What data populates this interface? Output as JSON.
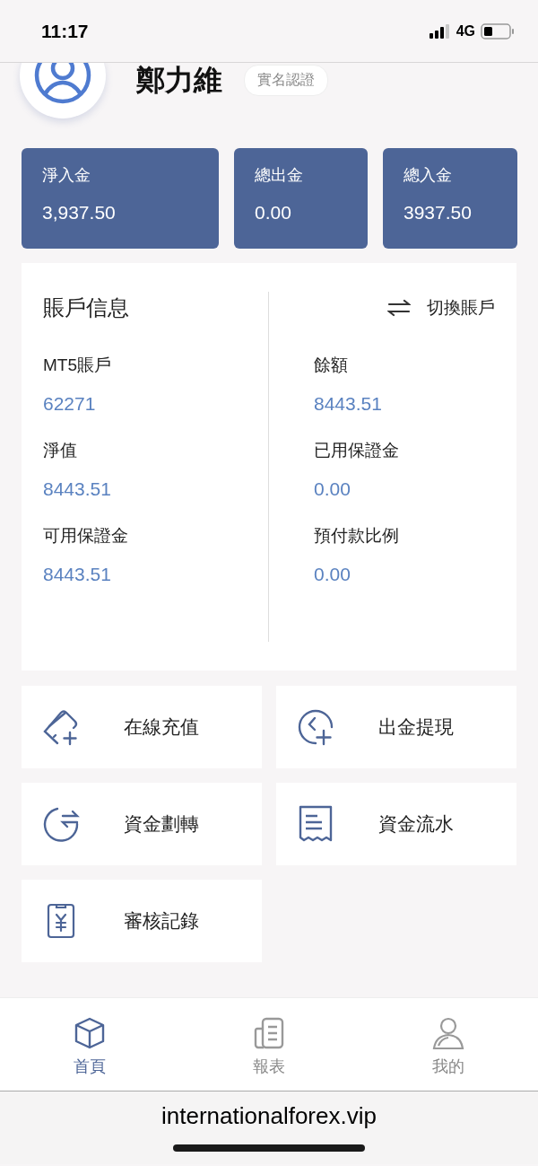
{
  "status_bar": {
    "time": "11:17",
    "network": "4G"
  },
  "profile": {
    "name": "鄭力維",
    "badge": "實名認證"
  },
  "summary": [
    {
      "label": "淨入金",
      "value": "3,937.50"
    },
    {
      "label": "總出金",
      "value": "0.00"
    },
    {
      "label": "總入金",
      "value": "3937.50"
    }
  ],
  "account": {
    "title": "賬戶信息",
    "switch_label": "切換賬戶",
    "fields": [
      {
        "label": "MT5賬戶",
        "value": "62271"
      },
      {
        "label": "餘額",
        "value": "8443.51"
      },
      {
        "label": "淨值",
        "value": "8443.51"
      },
      {
        "label": "已用保證金",
        "value": "0.00"
      },
      {
        "label": "可用保證金",
        "value": "8443.51"
      },
      {
        "label": "預付款比例",
        "value": "0.00"
      }
    ]
  },
  "actions": [
    {
      "label": "在線充值",
      "kind": "card-plus"
    },
    {
      "label": "出金提現",
      "kind": "circle-plus"
    },
    {
      "label": "資金劃轉",
      "kind": "transfer"
    },
    {
      "label": "資金流水",
      "kind": "receipt"
    },
    {
      "label": "審核記錄",
      "kind": "yen-doc"
    }
  ],
  "tabs": [
    {
      "label": "首頁",
      "kind": "home",
      "selected": true
    },
    {
      "label": "報表",
      "kind": "report",
      "selected": false
    },
    {
      "label": "我的",
      "kind": "user",
      "selected": false
    }
  ],
  "browser_url": "internationalforex.vip"
}
